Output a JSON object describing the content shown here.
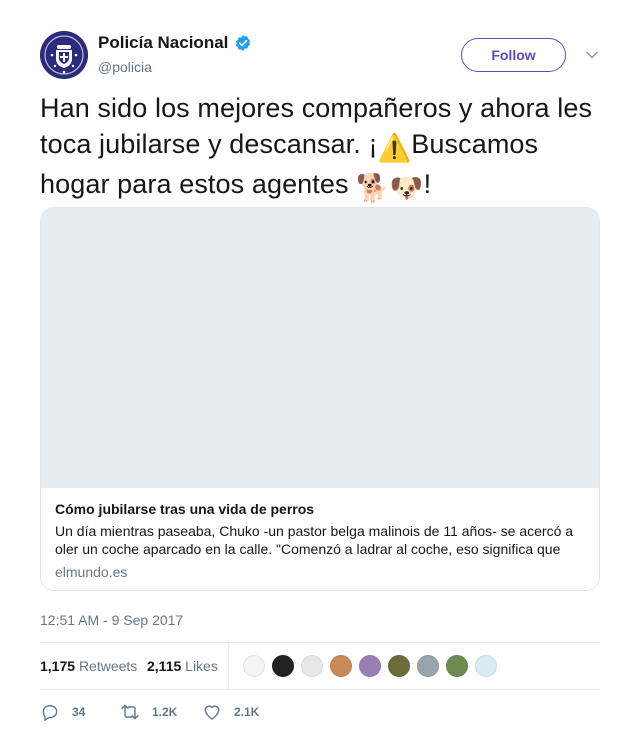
{
  "author": {
    "display_name": "Policía Nacional",
    "handle": "@policia",
    "verified_icon": "verified-badge-icon",
    "avatar_icon": "police-emblem-icon",
    "follow_label": "Follow"
  },
  "tweet": {
    "text_part1": "Han sido los mejores compañeros y ahora les toca jubilarse y descansar. ¡",
    "emoji_warning": "⚠️",
    "text_part2": "Buscamos hogar para estos agentes ",
    "emoji_dogs": "🐕🐶",
    "text_part3": "!"
  },
  "card": {
    "title": "Cómo jubilarse tras una vida de perros",
    "description": "Un día mientras paseaba, Chuko -un pastor belga malinois de 11 años- se acercó a oler un coche aparcado en la calle. \"Comenzó a ladrar al coche, eso significa que",
    "domain": "elmundo.es"
  },
  "timestamp": "12:51 AM - 9 Sep 2017",
  "stats": {
    "retweets_count": "1,175",
    "retweets_label": "Retweets",
    "likes_count": "2,115",
    "likes_label": "Likes",
    "liker_colors": [
      "#f5f5f5",
      "#222222",
      "#e8e8e8",
      "#c98a5a",
      "#9a7fb5",
      "#6d6a3c",
      "#9aa4ad",
      "#6f8a4f",
      "#d8ecf5"
    ]
  },
  "actions": {
    "replies": "34",
    "retweets": "1.2K",
    "likes": "2.1K"
  },
  "colors": {
    "accent": "#5b4cc4",
    "verified": "#1da1f2",
    "muted": "#657786"
  }
}
